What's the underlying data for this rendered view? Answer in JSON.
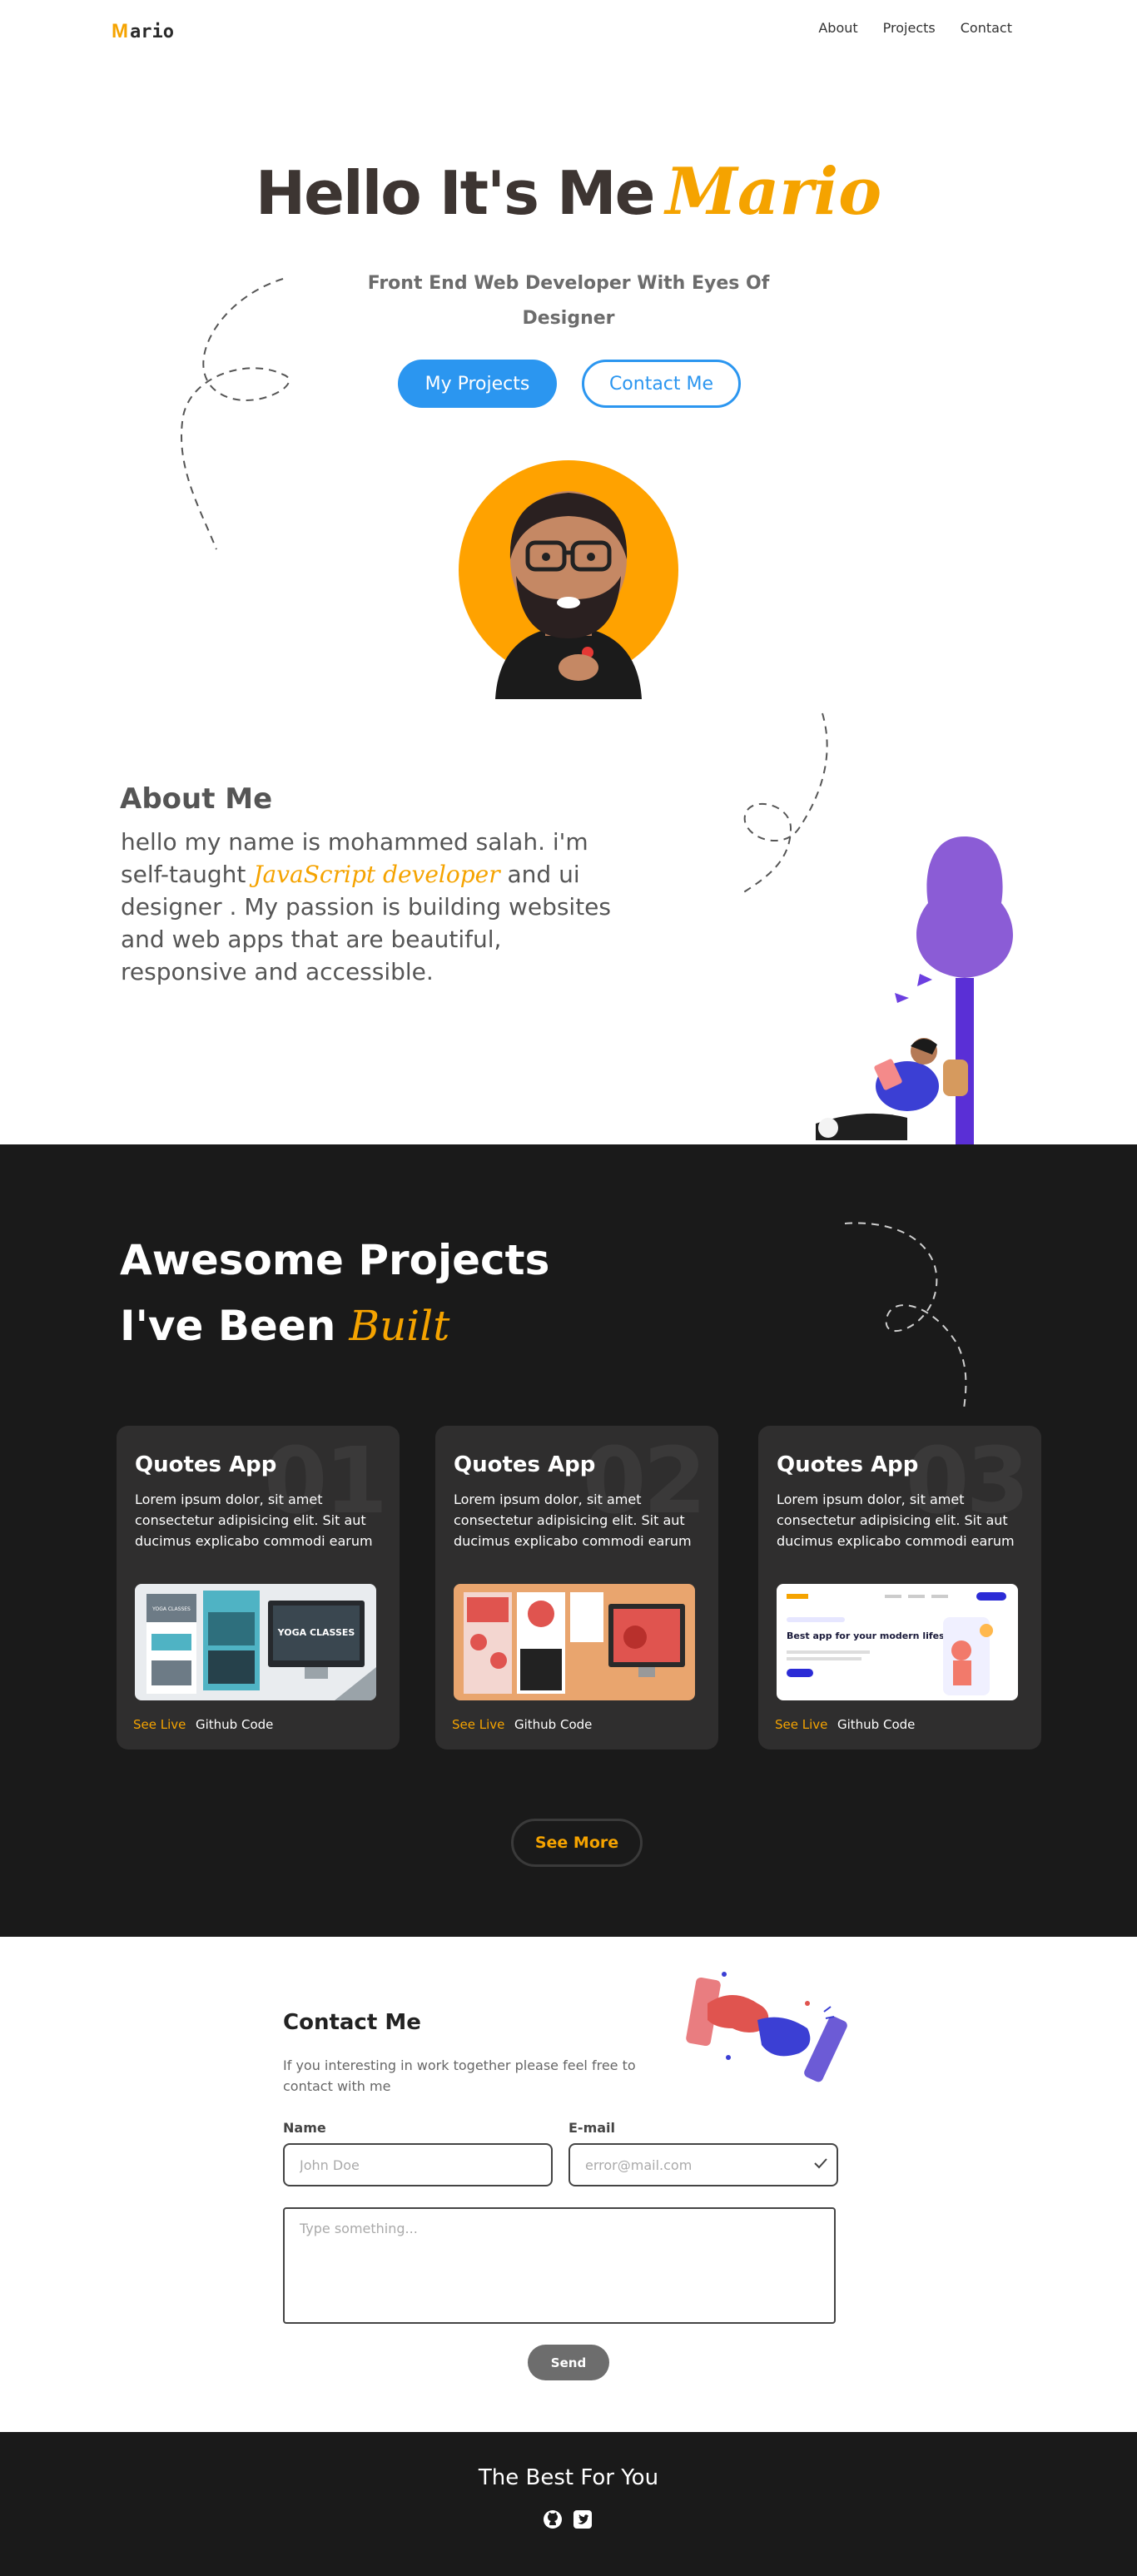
{
  "brand": {
    "logo_mark": "M",
    "logo_text": "ario",
    "accent": "#f5a300",
    "primary": "#2b96f0",
    "dark": "#1a1a1a"
  },
  "nav": {
    "links": [
      "About",
      "Projects",
      "Contact"
    ]
  },
  "hero": {
    "title_main": "Hello It's Me",
    "title_name": "Mario",
    "subtitle": "Front End Web Developer With Eyes Of Designer",
    "btn_projects": "My Projects",
    "btn_contact": "Contact Me"
  },
  "about": {
    "title": "About Me",
    "text_before": "hello my name is mohammed salah. i'm self-taught",
    "text_highlight": "JavaScript developer",
    "text_after": "and ui designer . My passion is building websites and web apps that are beautiful, responsive and accessible."
  },
  "projects": {
    "title_line1": "Awesome Projects",
    "title_line2": "I've Been",
    "title_highlight": "Built",
    "cards": [
      {
        "num": "01",
        "title": "Quotes App",
        "desc": "Lorem ipsum dolor, sit amet consectetur adipisicing elit. Sit aut ducimus explicabo commodi earum",
        "live": "See Live",
        "code": "Github Code"
      },
      {
        "num": "02",
        "title": "Quotes App",
        "desc": "Lorem ipsum dolor, sit amet consectetur adipisicing elit. Sit aut ducimus explicabo commodi earum",
        "live": "See Live",
        "code": "Github Code"
      },
      {
        "num": "03",
        "title": "Quotes App",
        "desc": "Lorem ipsum dolor, sit amet consectetur adipisicing elit. Sit aut ducimus explicabo commodi earum",
        "live": "See Live",
        "code": "Github Code"
      }
    ],
    "preview1": {
      "left_heading": "YOGA CLASSES",
      "right_heading": "YOGA CLASSES"
    },
    "preview3": {
      "heading": "Best app for your modern lifestyle"
    },
    "see_more": "See More"
  },
  "contact": {
    "title": "Contact Me",
    "subtitle": "If you interesting in work together please feel free to contact with me",
    "name_label": "Name",
    "name_placeholder": "John Doe",
    "email_label": "E-mail",
    "email_placeholder": "error@mail.com",
    "message_placeholder": "Type something...",
    "send": "Send"
  },
  "footer": {
    "text": "The Best For You",
    "icons": [
      "github-icon",
      "twitter-icon"
    ]
  }
}
